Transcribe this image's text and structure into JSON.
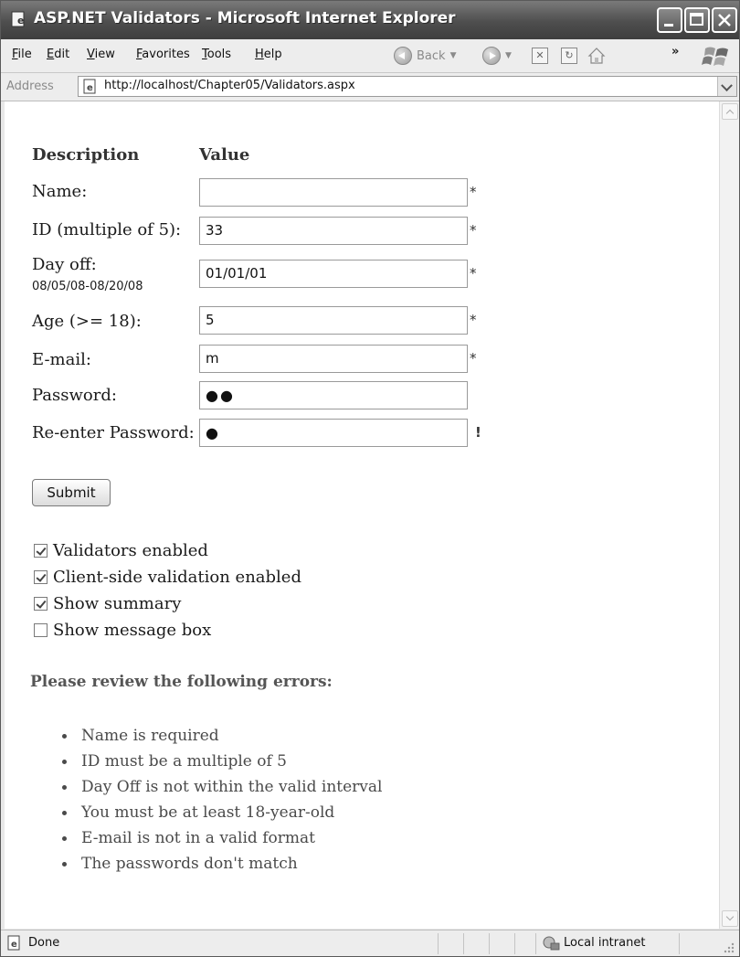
{
  "window": {
    "title": "ASP.NET Validators - Microsoft Internet Explorer"
  },
  "menu": {
    "items": [
      "File",
      "Edit",
      "View",
      "Favorites",
      "Tools",
      "Help"
    ]
  },
  "toolbar": {
    "back_label": "Back"
  },
  "address": {
    "label": "Address",
    "url": "http://localhost/Chapter05/Validators.aspx"
  },
  "form": {
    "headers": {
      "description": "Description",
      "value": "Value"
    },
    "rows": [
      {
        "label": "Name:",
        "value": "",
        "marker": "*"
      },
      {
        "label": "ID (multiple of 5):",
        "value": "33",
        "marker": "*"
      },
      {
        "label": "Day off:",
        "sublabel": "08/05/08-08/20/08",
        "value": "01/01/01",
        "marker": "*"
      },
      {
        "label": "Age (>= 18):",
        "value": "5",
        "marker": "*"
      },
      {
        "label": "E-mail:",
        "value": "m",
        "marker": "*"
      },
      {
        "label": "Password:",
        "value": "●●",
        "marker": ""
      },
      {
        "label": "Re-enter Password:",
        "value": "●",
        "marker": "!"
      }
    ],
    "submit_label": "Submit"
  },
  "options": [
    {
      "label": "Validators enabled",
      "checked": true
    },
    {
      "label": "Client-side validation enabled",
      "checked": true
    },
    {
      "label": "Show summary",
      "checked": true
    },
    {
      "label": "Show message box",
      "checked": false
    }
  ],
  "summary": {
    "title": "Please review the following errors:",
    "errors": [
      "Name is required",
      "ID must be a multiple of 5",
      "Day Off is not within the valid interval",
      "You must be at least 18-year-old",
      "E-mail is not in a valid format",
      "The passwords don't match"
    ]
  },
  "status": {
    "text": "Done",
    "zone": "Local intranet"
  }
}
